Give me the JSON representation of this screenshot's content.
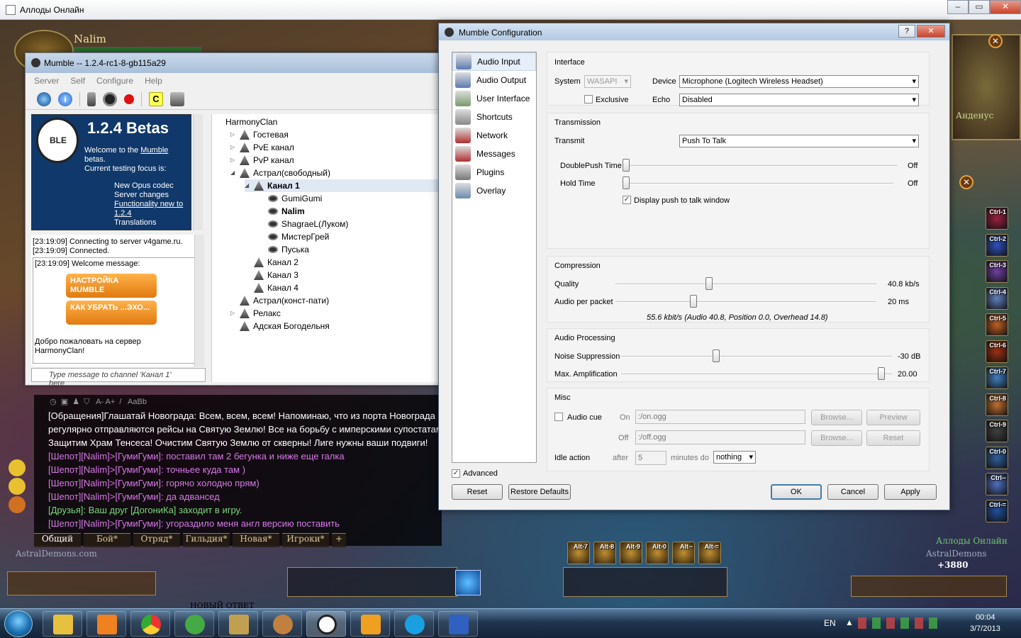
{
  "game": {
    "window_title": "Аллоды Онлайн",
    "player_name": "Nalim",
    "location_name": "Анденус",
    "guild_watermark": "AstralDemons.com",
    "currency": "+3880",
    "right_brand": "Аллоды Онлайн",
    "right_brand_sub": "AstralDemons",
    "forum_text": "НОВЫЙ ОТВЕТ",
    "ctrl_slots": [
      "Ctrl-1",
      "Ctrl-2",
      "Ctrl-3",
      "Ctrl-4",
      "Ctrl-5",
      "Ctrl-6",
      "Ctrl-7",
      "Ctrl-8",
      "Ctrl-9",
      "Ctrl-0",
      "Ctrl--",
      "Ctrl-="
    ],
    "alt_slots": [
      "Alt-7",
      "Alt-8",
      "Alt-9",
      "Alt-0",
      "Alt--",
      "Alt-="
    ],
    "chat": {
      "toolbar_font": "A- A+",
      "toolbar_aa": "AaBb",
      "lines": [
        {
          "text": "[Обращения]Глашатай Новограда: Всем, всем, всем! Напоминаю, что из порта Новограда",
          "color": "#ffffff"
        },
        {
          "text": "регулярно отправляются рейсы на Святую Землю! Все на борьбу с имперскими супостатами!",
          "color": "#ffffff"
        },
        {
          "text": "Защитим Храм Тенсеса! Очистим Святую Землю от скверны! Лиге нужны ваши подвиги!",
          "color": "#ffffff"
        },
        {
          "text": "[Шепот][Nalim]>[ГумиГуми]: поставил там 2 бегунка и ниже еще галка",
          "color": "#d878e8"
        },
        {
          "text": "[Шепот][Nalim]>[ГумиГуми]: точньее куда там )",
          "color": "#d878e8"
        },
        {
          "text": "[Шепот][Nalim]>[ГумиГуми]: горячо холодно прям)",
          "color": "#d878e8"
        },
        {
          "text": "[Шепот][Nalim]>[ГумиГуми]: да адвансед",
          "color": "#d878e8"
        },
        {
          "text": "[Друзья]: Ваш друг [ДогониКа] заходит в игру.",
          "color": "#7cd67c"
        },
        {
          "text": "[Шепот][Nalim]>[ГумиГуми]: угораздило меня англ версию поставить",
          "color": "#d878e8"
        }
      ],
      "tabs": [
        "Общий",
        "Бой*",
        "Отряд*",
        "Гильдия*",
        "Новая*",
        "Игроки*",
        "+"
      ]
    }
  },
  "mumble": {
    "title": "Mumble -- 1.2.4-rc1-8-gb115a29",
    "menu": [
      "Server",
      "Self",
      "Configure",
      "Help"
    ],
    "welcome": {
      "heading": "1.2.4 Betas",
      "logo_text": "BLE",
      "line1_pre": "Welcome to the ",
      "line1_link": "Mumble",
      "line2": "betas.",
      "line3": "Current testing focus is:",
      "items": [
        "New Opus codec",
        "Server changes",
        "Functionality new to",
        "1.2.4",
        "Translations"
      ]
    },
    "log": [
      "[23:19:09] Connecting to server v4game.ru.",
      "[23:19:09] Connected.",
      "[23:19:09] Welcome message:"
    ],
    "promo1": "НАСТРОЙКА MUMBLE",
    "promo2": "КАК УБРАТЬ ...ЭХО...",
    "welcome_server": "Добро пожаловать на сервер HarmonyClan!",
    "chat_placeholder": "Type message to channel 'Канал 1' here",
    "tree": [
      {
        "label": "HarmonyClan",
        "type": "root",
        "indent": 0,
        "arrow": ""
      },
      {
        "label": "Гостевая",
        "type": "channel",
        "indent": 1,
        "arrow": "▷"
      },
      {
        "label": "PvE канал",
        "type": "channel",
        "indent": 1,
        "arrow": "▷"
      },
      {
        "label": "PvP канал",
        "type": "channel",
        "indent": 1,
        "arrow": "▷"
      },
      {
        "label": "Астрал(свободный)",
        "type": "channel",
        "indent": 1,
        "arrow": "◢"
      },
      {
        "label": "Канал 1",
        "type": "channel",
        "indent": 2,
        "arrow": "◢",
        "bold": true,
        "selected": true
      },
      {
        "label": "GumiGumi",
        "type": "user",
        "indent": 3,
        "arrow": ""
      },
      {
        "label": "Nalim",
        "type": "user",
        "indent": 3,
        "arrow": "",
        "bold": true
      },
      {
        "label": "ShagraeL(Луком)",
        "type": "user",
        "indent": 3,
        "arrow": ""
      },
      {
        "label": "МистерГрей",
        "type": "user",
        "indent": 3,
        "arrow": ""
      },
      {
        "label": "Пуська",
        "type": "user",
        "indent": 3,
        "arrow": ""
      },
      {
        "label": "Канал 2",
        "type": "channel",
        "indent": 2,
        "arrow": ""
      },
      {
        "label": "Канал 3",
        "type": "channel",
        "indent": 2,
        "arrow": ""
      },
      {
        "label": "Канал 4",
        "type": "channel",
        "indent": 2,
        "arrow": ""
      },
      {
        "label": "Астрал(конст-пати)",
        "type": "channel",
        "indent": 1,
        "arrow": ""
      },
      {
        "label": "Релакс",
        "type": "channel",
        "indent": 1,
        "arrow": "▷"
      },
      {
        "label": "Адская Богодельня",
        "type": "channel",
        "indent": 1,
        "arrow": ""
      }
    ]
  },
  "config": {
    "title": "Mumble Configuration",
    "title_help": "?",
    "nav": [
      "Audio Input",
      "Audio Output",
      "User Interface",
      "Shortcuts",
      "Network",
      "Messages",
      "Plugins",
      "Overlay"
    ],
    "interface": {
      "label": "Interface",
      "system_label": "System",
      "system_value": "WASAPI",
      "device_label": "Device",
      "device_value": "Microphone (Logitech Wireless Headset)",
      "exclusive_label": "Exclusive",
      "echo_label": "Echo",
      "echo_value": "Disabled"
    },
    "transmission": {
      "label": "Transmission",
      "transmit_label": "Transmit",
      "transmit_value": "Push To Talk",
      "doublepush_label": "DoublePush Time",
      "doublepush_value": "Off",
      "holdtime_label": "Hold Time",
      "holdtime_value": "Off",
      "display_ptt_label": "Display push to talk window"
    },
    "compression": {
      "label": "Compression",
      "quality_label": "Quality",
      "quality_value": "40.8 kb/s",
      "quality_pos": 0.36,
      "app_label": "Audio per packet",
      "app_value": "20 ms",
      "app_pos": 0.3,
      "summary": "55.6 kbit/s (Audio 40.8, Position 0.0, Overhead 14.8)"
    },
    "processing": {
      "label": "Audio Processing",
      "noise_label": "Noise Suppression",
      "noise_value": "-30 dB",
      "noise_pos": 0.35,
      "amp_label": "Max. Amplification",
      "amp_value": "20.00",
      "amp_pos": 0.96
    },
    "misc": {
      "label": "Misc",
      "audio_cue_label": "Audio cue",
      "on_label": "On",
      "on_value": ":/on.ogg",
      "off_label": "Off",
      "off_value": ":/off.ogg",
      "browse1": "Browse...",
      "browse2": "Browse...",
      "preview": "Preview",
      "reset_cue": "Reset",
      "idle_label": "Idle action",
      "after_label": "after",
      "after_value": "5",
      "minutes_label": "minutes do",
      "idle_action_value": "nothing"
    },
    "advanced_label": "Advanced",
    "buttons": {
      "reset": "Reset",
      "restore": "Restore Defaults",
      "ok": "OK",
      "cancel": "Cancel",
      "apply": "Apply"
    }
  },
  "taskbar": {
    "lang": "EN",
    "time": "00:04",
    "date": "3/7/2013"
  }
}
